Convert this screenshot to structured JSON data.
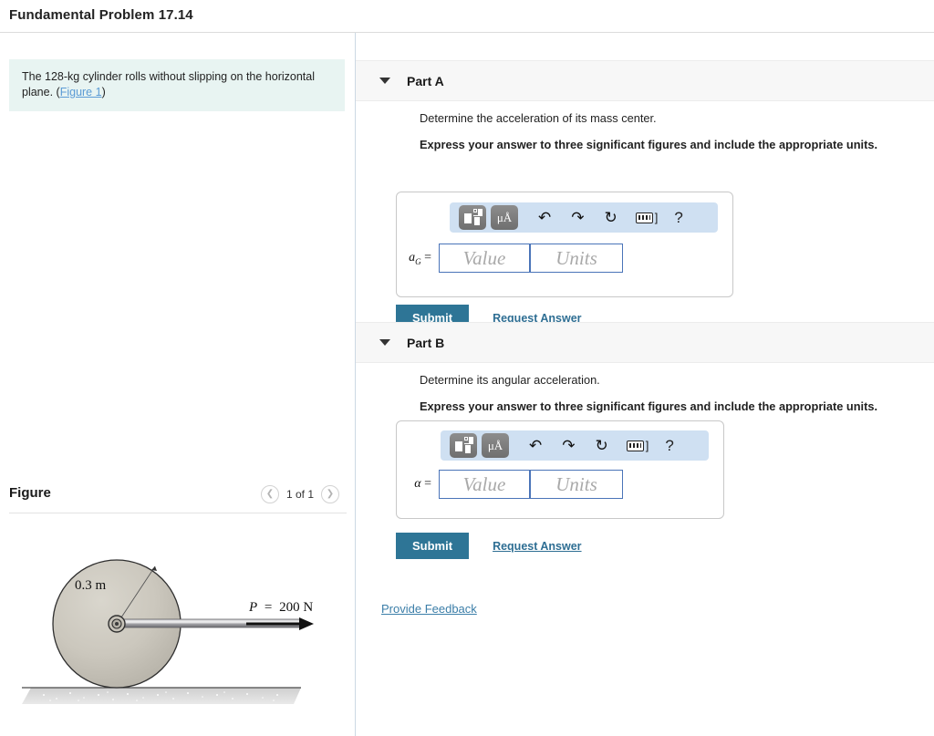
{
  "header": {
    "title": "Fundamental Problem 17.14"
  },
  "problem": {
    "statement_text": "The 128-kg cylinder rolls without slipping on the horizontal plane. ",
    "figure_link": "Figure 1",
    "statement_suffix": ")",
    "statement_prefix_paren": "("
  },
  "figure_panel": {
    "title": "Figure",
    "prev_icon": "chevron-left-icon",
    "next_icon": "chevron-right-icon",
    "counter": "1 of 1",
    "diagram": {
      "radius_label": "0.3 m",
      "force_label": "P = 200 N",
      "force_symbol": "P",
      "force_equals": "=",
      "force_value": "200 N"
    }
  },
  "toolbar": {
    "template_icon": "math-template-icon",
    "units_icon": "μÅ",
    "undo_icon": "↶",
    "redo_icon": "↷",
    "reset_icon": "↻",
    "keyboard_icon": "keyboard-icon",
    "keyboard_bracket": "]",
    "help_icon": "?"
  },
  "parts": [
    {
      "id": "A",
      "label": "Part A",
      "caret_icon": "caret-down-icon",
      "prompt": "Determine the acceleration of its mass center.",
      "instruction": "Express your answer to three significant figures and include the appropriate units.",
      "answer_symbol_base": "a",
      "answer_symbol_sub": "G",
      "answer_equals": "=",
      "value_placeholder": "Value",
      "units_placeholder": "Units",
      "submit_label": "Submit",
      "request_label": "Request Answer"
    },
    {
      "id": "B",
      "label": "Part B",
      "caret_icon": "caret-down-icon",
      "prompt": "Determine its angular acceleration.",
      "instruction": "Express your answer to three significant figures and include the appropriate units.",
      "answer_symbol_base": "α",
      "answer_symbol_sub": "",
      "answer_equals": "=",
      "value_placeholder": "Value",
      "units_placeholder": "Units",
      "submit_label": "Submit",
      "request_label": "Request Answer"
    }
  ],
  "footer": {
    "feedback_label": "Provide Feedback"
  },
  "colors": {
    "statement_bg": "#e8f4f2",
    "link": "#5b9bd5",
    "submit_bg": "#2e7596",
    "toolbar_bg": "#cfe0f2",
    "field_border": "#4a74b8",
    "part_header_bg": "#f7f7f7"
  }
}
